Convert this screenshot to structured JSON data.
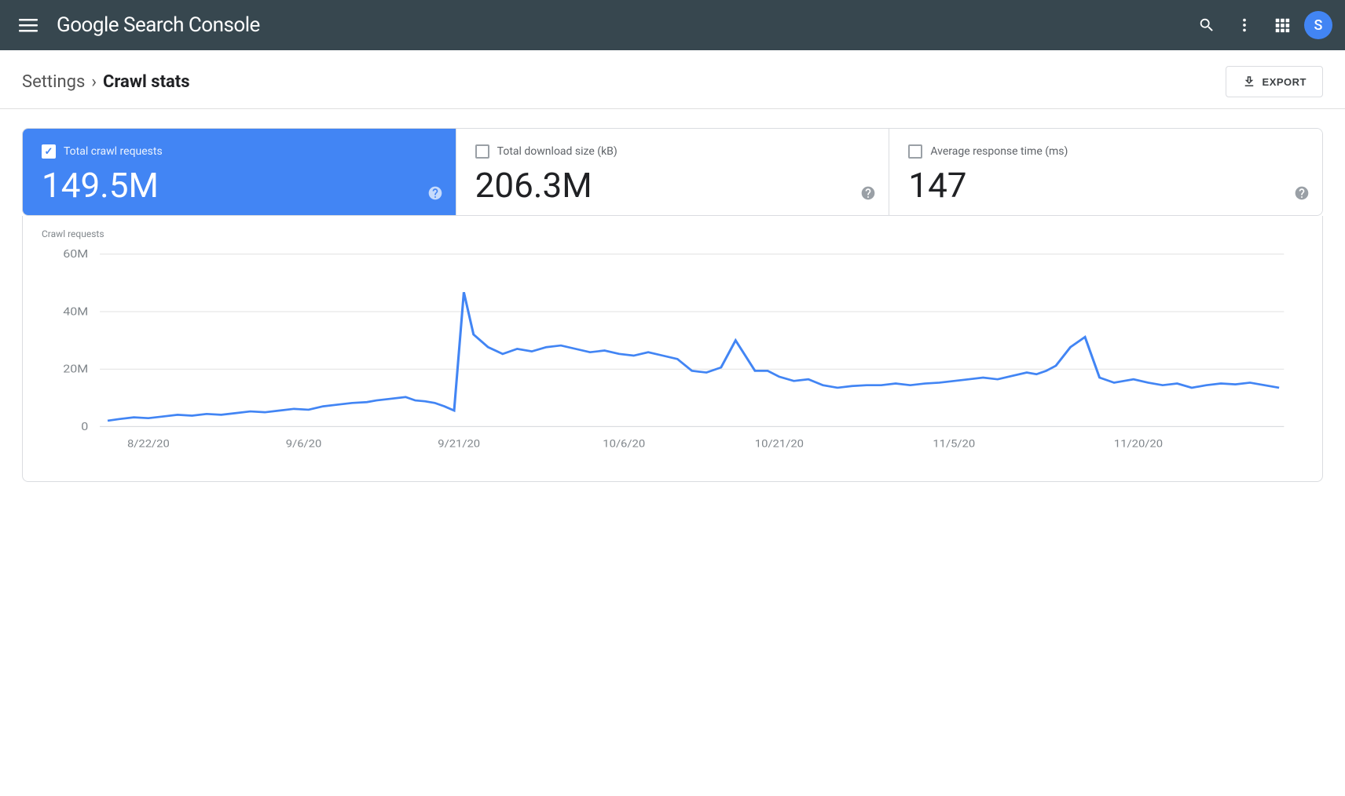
{
  "header": {
    "title": "Google Search Console",
    "menu_icon": "☰",
    "search_icon": "🔍",
    "more_icon": "⋮",
    "apps_icon": "⠿",
    "avatar_letter": "S",
    "avatar_color": "#4285f4"
  },
  "breadcrumb": {
    "settings_label": "Settings",
    "separator": "›",
    "current_label": "Crawl stats"
  },
  "export_button": {
    "label": "EXPORT"
  },
  "stat_cards": [
    {
      "id": "total-crawl-requests",
      "label": "Total crawl requests",
      "value": "149.5M",
      "active": true
    },
    {
      "id": "total-download-size",
      "label": "Total download size (kB)",
      "value": "206.3M",
      "active": false
    },
    {
      "id": "avg-response-time",
      "label": "Average response time (ms)",
      "value": "147",
      "active": false
    }
  ],
  "chart": {
    "y_axis_label": "Crawl requests",
    "y_labels": [
      "0",
      "20M",
      "40M",
      "60M"
    ],
    "x_labels": [
      "8/22/20",
      "9/6/20",
      "9/21/20",
      "10/6/20",
      "10/21/20",
      "11/5/20",
      "11/20/20"
    ],
    "line_color": "#4285f4",
    "grid_color": "#e0e0e0"
  }
}
